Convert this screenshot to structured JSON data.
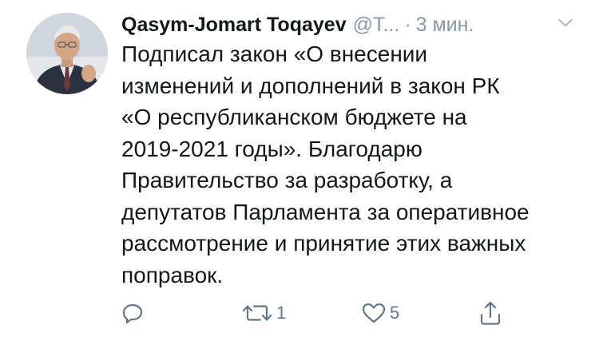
{
  "tweet": {
    "author_name": "Qasym-Jomart Toqayev",
    "handle": "@T...",
    "separator": "·",
    "time": "3 мин.",
    "text_lines": [
      "Подписал закон «О внесении",
      "изменений и дополнений в закон РК",
      "«О республиканском бюджете на",
      "2019-2021 годы». Благодарю",
      "Правительство за разработку, а",
      "депутатов Парламента за оперативное",
      "рассмотрение и принятие этих важных",
      "поправок."
    ]
  },
  "actions": {
    "reply_count": "",
    "retweet_count": "1",
    "like_count": "5"
  },
  "icons": {
    "reply": "reply-icon",
    "retweet": "retweet-icon",
    "like": "heart-icon",
    "share": "share-icon",
    "menu": "chevron-down-icon"
  },
  "colors": {
    "text": "#14171a",
    "secondary": "#8899a6",
    "action": "#657786"
  }
}
